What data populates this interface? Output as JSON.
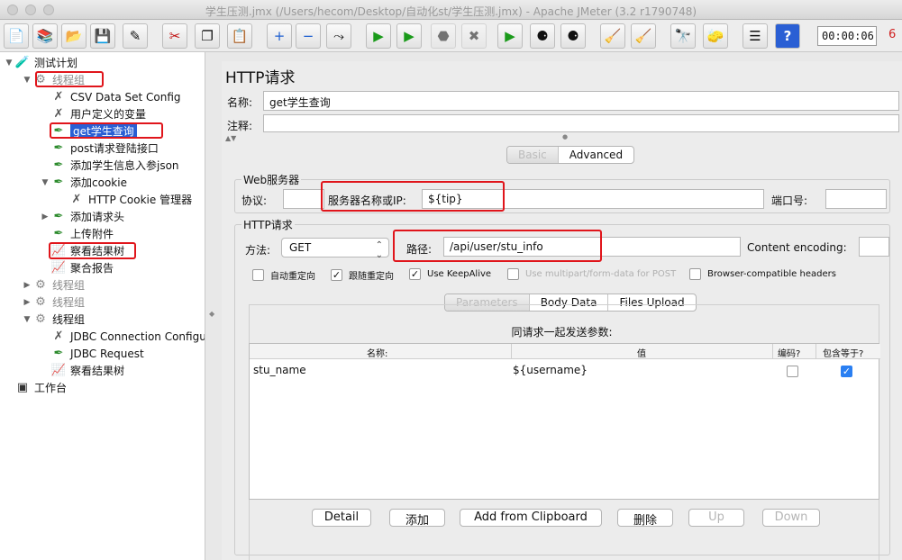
{
  "window": {
    "title": "学生压测.jmx (/Users/hecom/Desktop/自动化st/学生压测.jmx) - Apache JMeter (3.2 r1790748)"
  },
  "toolbar": {
    "timer": "00:00:06",
    "active_threads": "6",
    "buttons": [
      {
        "name": "new-icon",
        "glyph": "📄"
      },
      {
        "name": "templates-icon",
        "glyph": "📚"
      },
      {
        "name": "open-icon",
        "glyph": "📂"
      },
      {
        "name": "save-icon",
        "glyph": "💾"
      },
      {
        "name": "save-as-icon",
        "glyph": "✎"
      },
      {
        "name": "cut-icon",
        "glyph": "✂"
      },
      {
        "name": "copy-icon",
        "glyph": "❐"
      },
      {
        "name": "paste-icon",
        "glyph": "📋"
      },
      {
        "name": "expand-icon",
        "glyph": "+"
      },
      {
        "name": "collapse-icon",
        "glyph": "−"
      },
      {
        "name": "toggle-icon",
        "glyph": "⤳"
      },
      {
        "name": "start-icon",
        "glyph": "▶"
      },
      {
        "name": "start-no-pause-icon",
        "glyph": "▶"
      },
      {
        "name": "stop-icon",
        "glyph": "⬣"
      },
      {
        "name": "shutdown-icon",
        "glyph": "✖"
      },
      {
        "name": "remote-start-icon",
        "glyph": "▶"
      },
      {
        "name": "remote-stop-icon",
        "glyph": "⚈"
      },
      {
        "name": "remote-shutdown-icon",
        "glyph": "⚈"
      },
      {
        "name": "clear-icon",
        "glyph": "🧹"
      },
      {
        "name": "clear-all-icon",
        "glyph": "🧹"
      },
      {
        "name": "search-icon",
        "glyph": "🔭"
      },
      {
        "name": "reset-search-icon",
        "glyph": "🧽"
      },
      {
        "name": "function-helper-icon",
        "glyph": "☰"
      },
      {
        "name": "help-icon",
        "glyph": "?"
      }
    ]
  },
  "tree": {
    "items": [
      {
        "label": "测试计划",
        "icon": "test-plan-icon",
        "glyph": "🧪",
        "twisty": "▼",
        "indent": 0,
        "dim": false,
        "selected": false
      },
      {
        "label": "线程组",
        "icon": "thread-group-icon",
        "glyph": "⚙",
        "twisty": "▼",
        "indent": 1,
        "dim": true,
        "selected": false
      },
      {
        "label": "CSV Data Set Config",
        "icon": "config-element-icon",
        "glyph": "✗",
        "twisty": "",
        "indent": 2,
        "dim": false,
        "selected": false
      },
      {
        "label": "用户定义的变量",
        "icon": "config-element-icon",
        "glyph": "✗",
        "twisty": "",
        "indent": 2,
        "dim": false,
        "selected": false
      },
      {
        "label": "get学生查询",
        "icon": "sampler-icon",
        "glyph": "✒",
        "twisty": "",
        "indent": 2,
        "dim": false,
        "selected": true
      },
      {
        "label": "post请求登陆接口",
        "icon": "sampler-icon",
        "glyph": "✒",
        "twisty": "",
        "indent": 2,
        "dim": false,
        "selected": false
      },
      {
        "label": "添加学生信息入参json",
        "icon": "sampler-icon",
        "glyph": "✒",
        "twisty": "",
        "indent": 2,
        "dim": false,
        "selected": false
      },
      {
        "label": "添加cookie",
        "icon": "sampler-icon",
        "glyph": "✒",
        "twisty": "▼",
        "indent": 2,
        "dim": false,
        "selected": false
      },
      {
        "label": "HTTP Cookie 管理器",
        "icon": "config-element-icon",
        "glyph": "✗",
        "twisty": "",
        "indent": 3,
        "dim": false,
        "selected": false
      },
      {
        "label": "添加请求头",
        "icon": "sampler-icon",
        "glyph": "✒",
        "twisty": "▶",
        "indent": 2,
        "dim": false,
        "selected": false
      },
      {
        "label": "上传附件",
        "icon": "sampler-icon",
        "glyph": "✒",
        "twisty": "",
        "indent": 2,
        "dim": false,
        "selected": false
      },
      {
        "label": "察看结果树",
        "icon": "listener-icon",
        "glyph": "📈",
        "twisty": "",
        "indent": 2,
        "dim": false,
        "selected": false
      },
      {
        "label": "聚合报告",
        "icon": "listener-icon",
        "glyph": "📈",
        "twisty": "",
        "indent": 2,
        "dim": false,
        "selected": false
      },
      {
        "label": "线程组",
        "icon": "thread-group-icon",
        "glyph": "⚙",
        "twisty": "▶",
        "indent": 1,
        "dim": true,
        "selected": false
      },
      {
        "label": "线程组",
        "icon": "thread-group-icon",
        "glyph": "⚙",
        "twisty": "▶",
        "indent": 1,
        "dim": true,
        "selected": false
      },
      {
        "label": "线程组",
        "icon": "thread-group-icon",
        "glyph": "⚙",
        "twisty": "▼",
        "indent": 1,
        "dim": false,
        "selected": false
      },
      {
        "label": "JDBC Connection Configu",
        "icon": "config-element-icon",
        "glyph": "✗",
        "twisty": "",
        "indent": 2,
        "dim": false,
        "selected": false
      },
      {
        "label": "JDBC Request",
        "icon": "sampler-icon",
        "glyph": "✒",
        "twisty": "",
        "indent": 2,
        "dim": false,
        "selected": false
      },
      {
        "label": "察看结果树",
        "icon": "listener-icon",
        "glyph": "📈",
        "twisty": "",
        "indent": 2,
        "dim": false,
        "selected": false
      },
      {
        "label": "工作台",
        "icon": "workbench-icon",
        "glyph": "▣",
        "twisty": "",
        "indent": 0,
        "dim": false,
        "selected": false
      }
    ]
  },
  "panel": {
    "title": "HTTP请求",
    "name_label": "名称:",
    "name_value": "get学生查询",
    "comment_label": "注释:",
    "comment_value": "",
    "top_tabs": [
      "Basic",
      "Advanced"
    ],
    "web_server": {
      "title": "Web服务器",
      "protocol_label": "协议:",
      "protocol_value": "",
      "server_label": "服务器名称或IP:",
      "server_value": "${tip}",
      "port_label": "端口号:",
      "port_value": ""
    },
    "http_request": {
      "title": "HTTP请求",
      "method_label": "方法:",
      "method_value": "GET",
      "path_label": "路径:",
      "path_value": "/api/user/stu_info",
      "encoding_label": "Content encoding:",
      "encoding_value": ""
    },
    "checkboxes": [
      {
        "label": "自动重定向",
        "checked": false,
        "disabled": false
      },
      {
        "label": "跟随重定向",
        "checked": true,
        "disabled": false
      },
      {
        "label": "Use KeepAlive",
        "checked": true,
        "disabled": false
      },
      {
        "label": "Use multipart/form-data for POST",
        "checked": false,
        "disabled": true
      },
      {
        "label": "Browser-compatible headers",
        "checked": false,
        "disabled": false
      }
    ],
    "param_tabs": [
      "Parameters",
      "Body Data",
      "Files Upload"
    ],
    "params_title": "同请求一起发送参数:",
    "columns": [
      "名称:",
      "值",
      "编码?",
      "包含等于?"
    ],
    "rows": [
      {
        "name": "stu_name",
        "value": "${username}",
        "encode": false,
        "include_equals": true
      }
    ],
    "buttons": [
      {
        "label": "Detail",
        "disabled": false
      },
      {
        "label": "添加",
        "disabled": false
      },
      {
        "label": "Add from Clipboard",
        "disabled": false
      },
      {
        "label": "删除",
        "disabled": false
      },
      {
        "label": "Up",
        "disabled": true
      },
      {
        "label": "Down",
        "disabled": true
      }
    ]
  }
}
